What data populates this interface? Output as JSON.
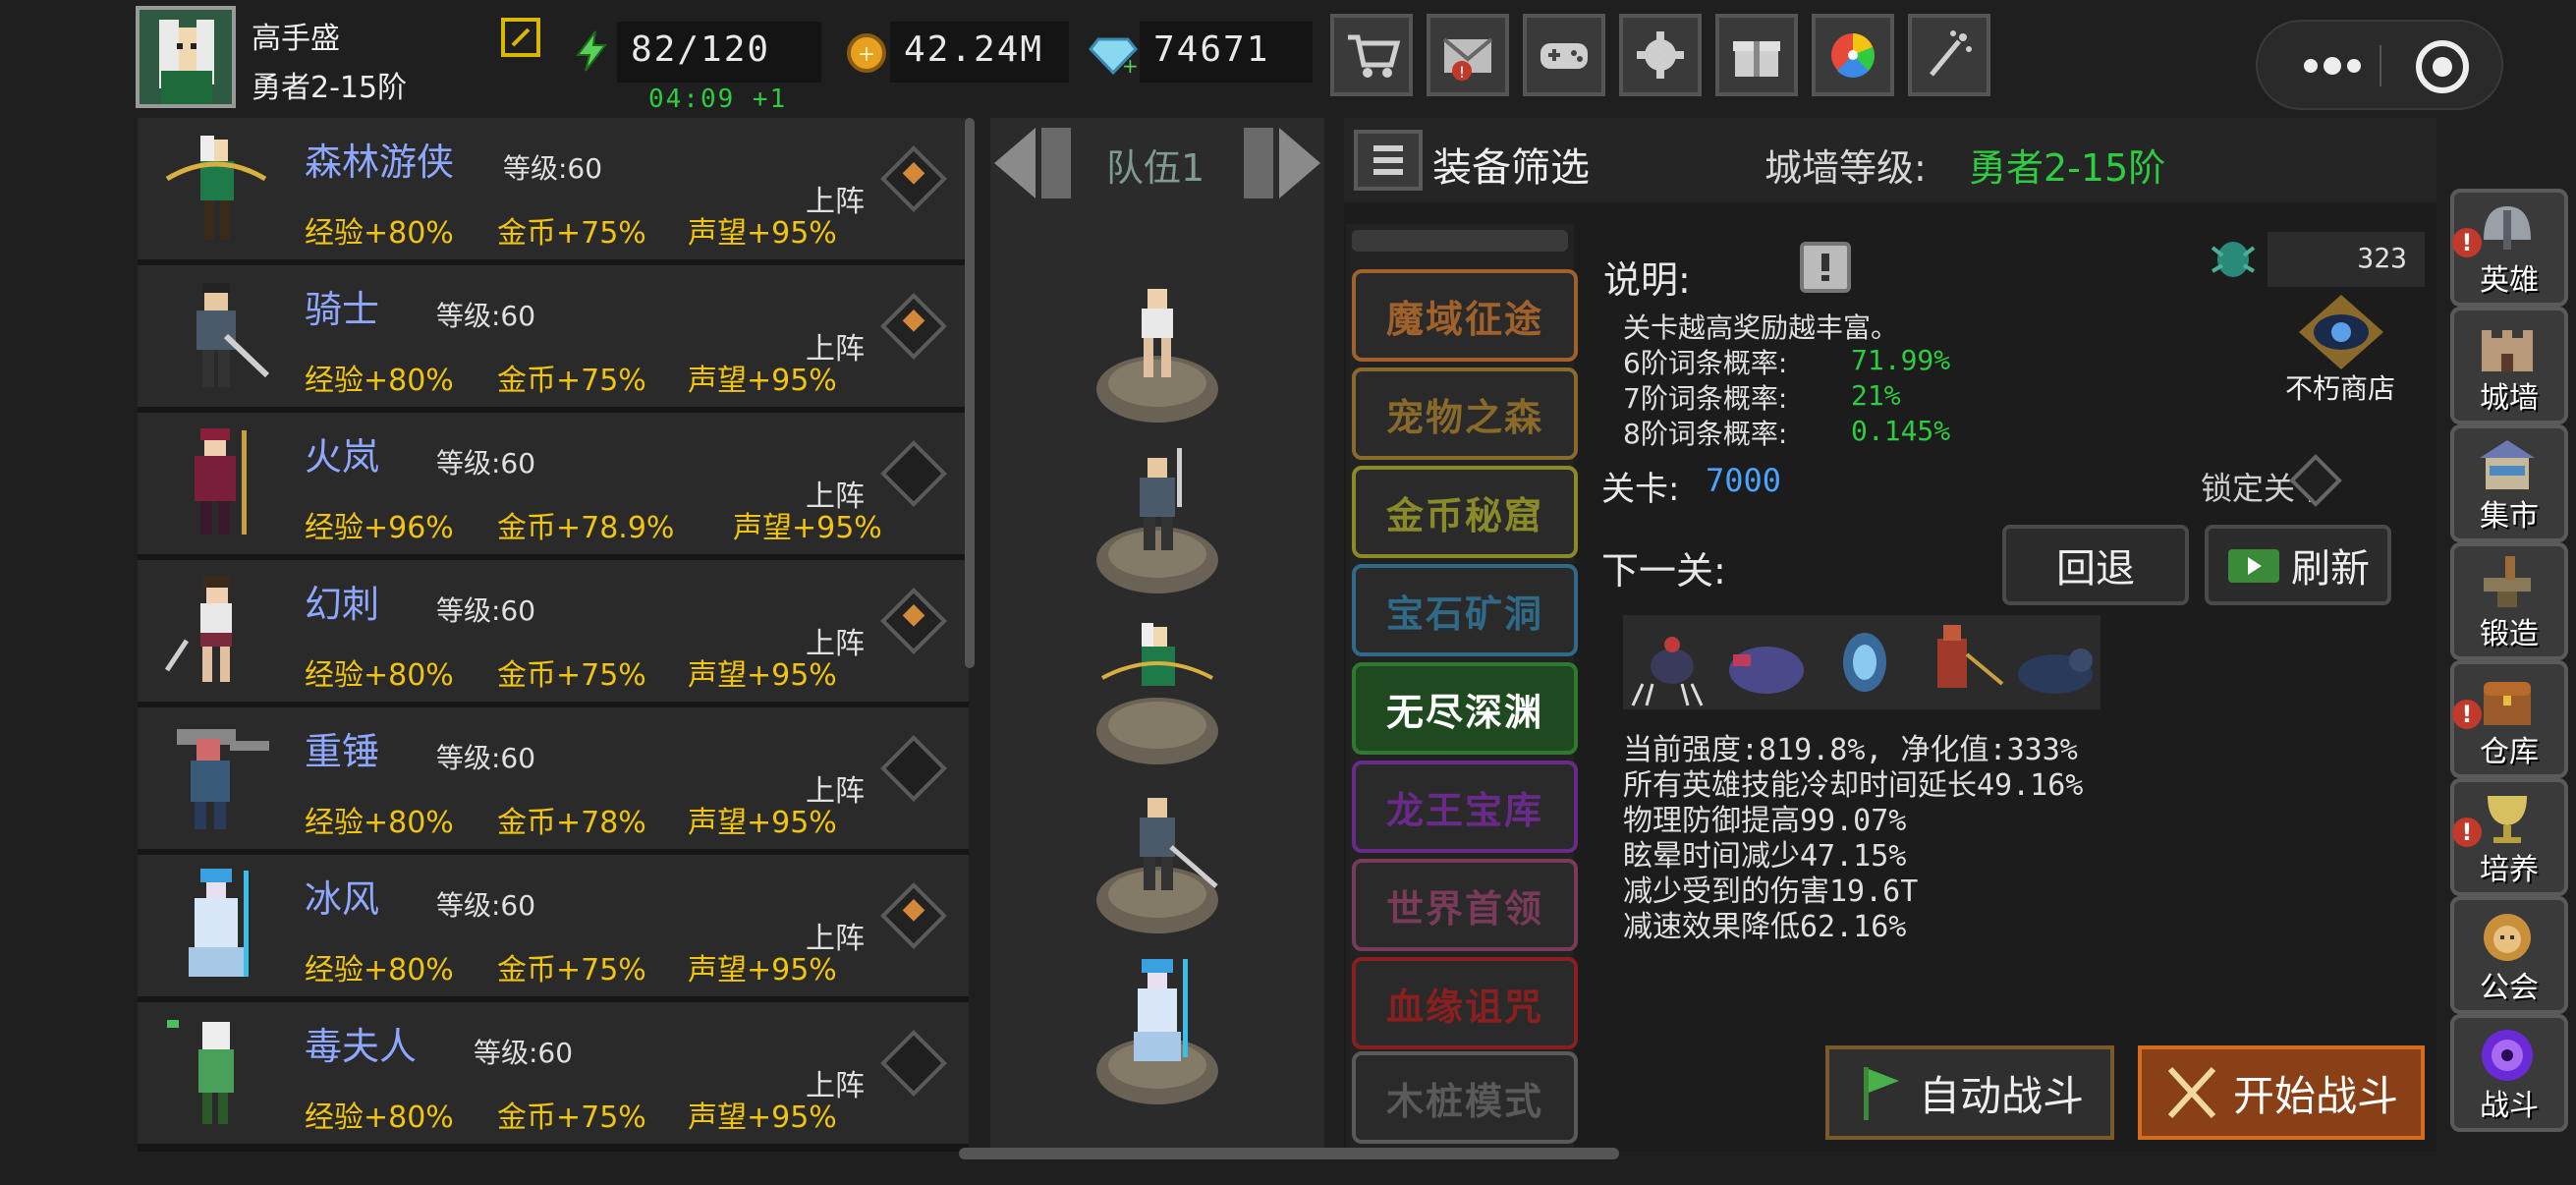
{
  "player": {
    "name": "高手盛",
    "rank": "勇者2-15阶"
  },
  "resources": {
    "energy": "82/120",
    "energy_timer": "04:09 +1",
    "gold": "42.24M",
    "gems": "74671"
  },
  "toolbar_icons": [
    "cart-icon",
    "mail-icon",
    "gamepad-icon",
    "gear-icon",
    "gift-icon",
    "wheel-icon",
    "sparkle-icon"
  ],
  "heroes": [
    {
      "name": "森林游侠",
      "level": "等级:60",
      "exp": "经验+80%",
      "gold": "金币+75%",
      "rep": "声望+95%",
      "deploy": "上阵",
      "deployed": true
    },
    {
      "name": "骑士",
      "level": "等级:60",
      "exp": "经验+80%",
      "gold": "金币+75%",
      "rep": "声望+95%",
      "deploy": "上阵",
      "deployed": true
    },
    {
      "name": "火岚",
      "level": "等级:60",
      "exp": "经验+96%",
      "gold": "金币+78.9%",
      "rep": "声望+95%",
      "deploy": "上阵",
      "deployed": false
    },
    {
      "name": "幻刺",
      "level": "等级:60",
      "exp": "经验+80%",
      "gold": "金币+75%",
      "rep": "声望+95%",
      "deploy": "上阵",
      "deployed": true
    },
    {
      "name": "重锤",
      "level": "等级:60",
      "exp": "经验+80%",
      "gold": "金币+78%",
      "rep": "声望+95%",
      "deploy": "上阵",
      "deployed": false
    },
    {
      "name": "冰风",
      "level": "等级:60",
      "exp": "经验+80%",
      "gold": "金币+75%",
      "rep": "声望+95%",
      "deploy": "上阵",
      "deployed": true
    },
    {
      "name": "毒夫人",
      "level": "等级:60",
      "exp": "经验+80%",
      "gold": "金币+75%",
      "rep": "声望+95%",
      "deploy": "上阵",
      "deployed": false
    }
  ],
  "team": {
    "label": "队伍1"
  },
  "header": {
    "filter": "装备筛选",
    "wall_label": "城墙等级:",
    "wall_value": "勇者2-15阶"
  },
  "modes": [
    {
      "label": "魔域征途",
      "color": "#a0622a"
    },
    {
      "label": "宠物之森",
      "color": "#8a6a2a"
    },
    {
      "label": "金币秘窟",
      "color": "#8a8a28"
    },
    {
      "label": "宝石矿洞",
      "color": "#2f6a88"
    },
    {
      "label": "无尽深渊",
      "color": "#2f7a2f"
    },
    {
      "label": "龙王宝库",
      "color": "#6a2a8a"
    },
    {
      "label": "世界首领",
      "color": "#7a3a5a"
    },
    {
      "label": "血缘诅咒",
      "color": "#8a1f1f"
    },
    {
      "label": "木桩模式",
      "color": "#5a5a5a"
    }
  ],
  "selected_mode": 4,
  "info": {
    "desc_label": "说明:",
    "count": "323",
    "line1": "关卡越高奖励越丰富。",
    "rate6_label": "6阶词条概率:",
    "rate6": "71.99%",
    "rate7_label": "7阶词条概率:",
    "rate7": "21%",
    "rate8_label": "8阶词条概率:",
    "rate8": "0.145%",
    "shop": "不朽商店",
    "stage_label": "关卡:",
    "stage": "7000",
    "lock_label": "锁定关卡",
    "next_label": "下一关:",
    "back": "回退",
    "refresh": "刷新",
    "effects": [
      "当前强度:819.8%, 净化值:333%",
      "所有英雄技能冷却时间延长49.16%",
      "物理防御提高99.07%",
      "眩晕时间减少47.15%",
      "减少受到的伤害19.6T",
      "减速效果降低62.16%"
    ],
    "auto": "自动战斗",
    "start": "开始战斗"
  },
  "nav": [
    {
      "label": "英雄",
      "icon": "helmet-icon",
      "alert": true
    },
    {
      "label": "城墙",
      "icon": "castle-icon",
      "alert": false
    },
    {
      "label": "集市",
      "icon": "market-icon",
      "alert": false
    },
    {
      "label": "锻造",
      "icon": "anvil-icon",
      "alert": false
    },
    {
      "label": "仓库",
      "icon": "chest-icon",
      "alert": true
    },
    {
      "label": "培养",
      "icon": "grail-icon",
      "alert": true
    },
    {
      "label": "公会",
      "icon": "lion-icon",
      "alert": false
    },
    {
      "label": "战斗",
      "icon": "portal-icon",
      "alert": false
    }
  ]
}
